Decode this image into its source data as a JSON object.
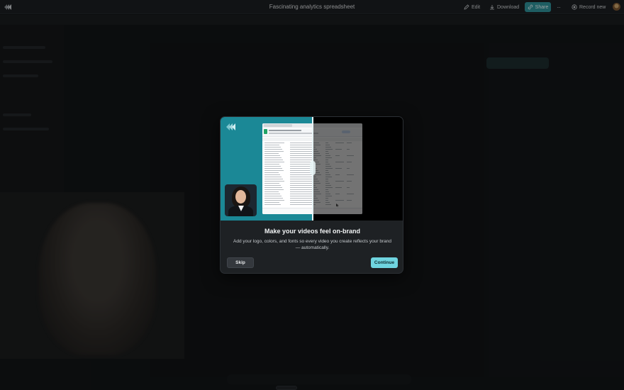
{
  "window": {
    "title": "Fascinating analytics spreadsheet"
  },
  "toolbar": {
    "edit_label": "Edit",
    "download_label": "Download",
    "share_label": "Share",
    "more_label": "···",
    "record_label": "Record new"
  },
  "icons": {
    "logo": "brand-logo-icon",
    "edit": "pencil-icon",
    "download": "download-icon",
    "share": "link-icon",
    "record": "record-icon",
    "avatar": "user-avatar"
  },
  "modal": {
    "title": "Make your videos feel on-brand",
    "description": "Add your logo, colors, and fonts so every video you create reflects your brand — automatically.",
    "skip_label": "Skip",
    "continue_label": "Continue"
  },
  "colors": {
    "accent": "#2f8f97",
    "hero_teal": "#1b8896",
    "continue_button": "#6fd4df"
  }
}
